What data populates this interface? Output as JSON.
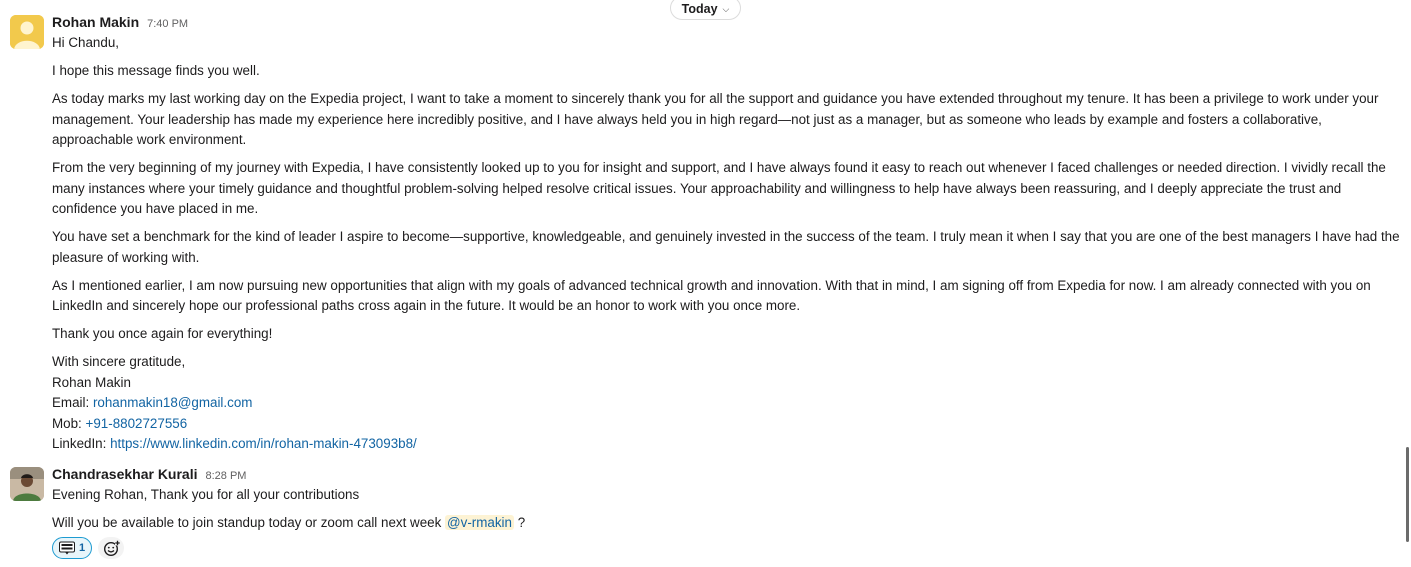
{
  "date_divider": {
    "label": "Today"
  },
  "messages": [
    {
      "author": "Rohan Makin",
      "time": "7:40 PM",
      "paragraphs": {
        "greeting": "Hi Chandu,",
        "p1": "I hope this message finds you well.",
        "p2": "As today marks my last working day on the Expedia project, I want to take a moment to sincerely thank you for all the support and guidance you have extended throughout my tenure. It has been a privilege to work under your management. Your leadership has made my experience here incredibly positive, and I have always held you in high regard—not just as a manager, but as someone who leads by example and fosters a collaborative, approachable work environment.",
        "p3": "From the very beginning of my journey with Expedia, I have consistently looked up to you for insight and support, and I have always found it easy to reach out whenever I faced challenges or needed direction. I vividly recall the many instances where your timely guidance and thoughtful problem-solving helped resolve critical issues. Your approachability and willingness to help have always been reassuring, and I deeply appreciate the trust and confidence you have placed in me.",
        "p4": "You have set a benchmark for the kind of leader I aspire to become—supportive, knowledgeable, and genuinely invested in the success of the team. I truly mean it when I say that you are one of the best managers I have had the pleasure of working with.",
        "p5": "As I mentioned earlier, I am now pursuing new opportunities that align with my goals of advanced technical growth and innovation. With that in mind, I am signing off from Expedia for now. I am already connected with you on LinkedIn and sincerely hope our professional paths cross again in the future. It would be an honor to work with you once more.",
        "p6": "Thank you once again for everything!"
      },
      "signature": {
        "closing": "With sincere gratitude,",
        "name": "Rohan Makin",
        "email_label": "Email:",
        "email": "rohanmakin18@gmail.com",
        "mob_label": "Mob:",
        "mob": "+91-8802727556",
        "linkedin_label": "LinkedIn:",
        "linkedin": "https://www.linkedin.com/in/rohan-makin-473093b8/"
      }
    },
    {
      "author": "Chandrasekhar Kurali",
      "time": "8:28 PM",
      "line1": "Evening Rohan, Thank you for all your contributions",
      "line2_before": "Will you be available to join standup today or zoom call next week",
      "mention": "@v-rmakin",
      "line2_after": "?",
      "reaction": {
        "icon": "thank-you-emoji-icon",
        "count": "1"
      },
      "add_reaction_icon": "add-reaction-icon"
    }
  ],
  "colors": {
    "link": "#1264a3",
    "mention_bg": "#fdf3d4",
    "reaction_border": "#1d9bd1",
    "reaction_bg": "#e8f5fa",
    "avatar_rohan": "#f2c94c"
  }
}
